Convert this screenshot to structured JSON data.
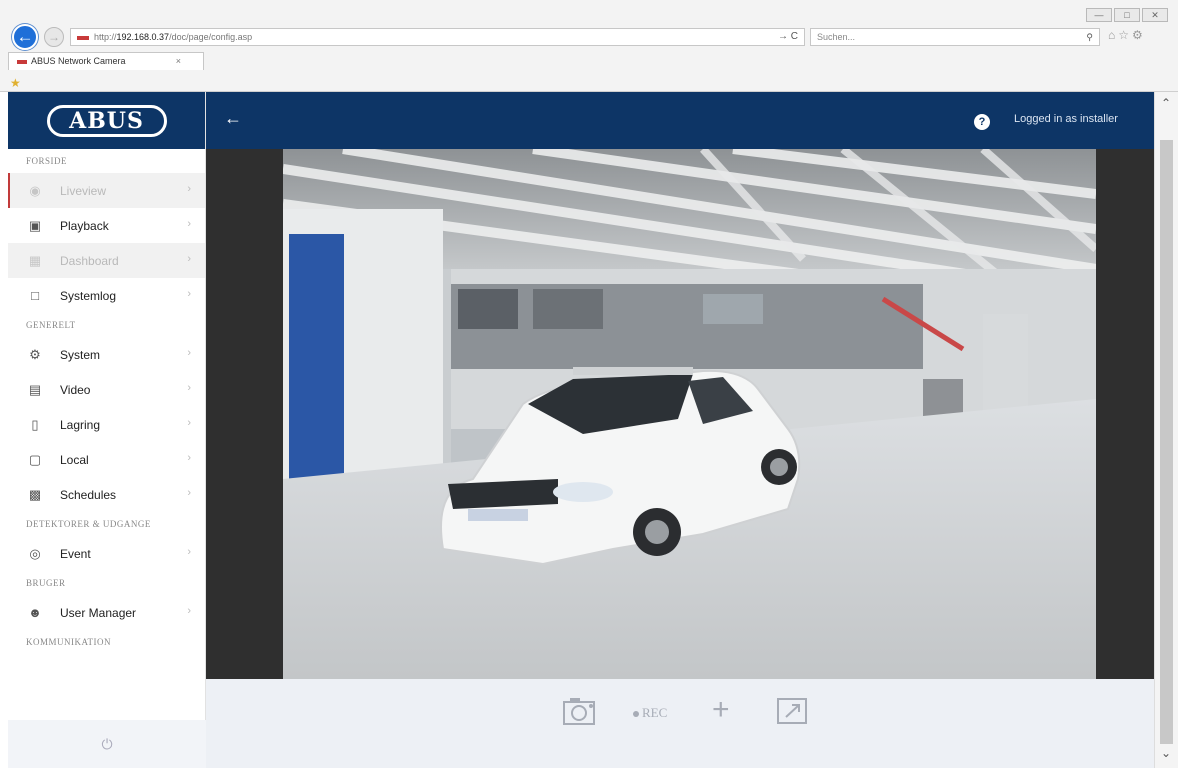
{
  "browser": {
    "url_prefix": "http://",
    "url_host": "192.168.0.37",
    "url_path": "/doc/page/config.asp",
    "url_tools": "→ C",
    "search_placeholder": "Suchen...",
    "search_icon": "search-icon",
    "tab_title": "ABUS Network Camera",
    "tab_close": "×"
  },
  "logo": {
    "text": "ABUS"
  },
  "sidebar": {
    "section_forside": "FORSIDE",
    "section_generelt": "GENERELT",
    "section_detektorer": "DETEKTORER & UDGANGE",
    "section_bruger": "BRUGER",
    "section_kommunikation": "KOMMUNIKATION",
    "items": {
      "liveview": {
        "label": "Liveview",
        "icon": "camera-icon"
      },
      "playback": {
        "label": "Playback",
        "icon": "playback-icon"
      },
      "dashboard": {
        "label": "Dashboard",
        "icon": "dashboard-icon"
      },
      "systemlog": {
        "label": "Systemlog",
        "icon": "document-icon"
      },
      "system": {
        "label": "System",
        "icon": "gear-icon"
      },
      "video": {
        "label": "Video",
        "icon": "video-icon"
      },
      "lagring": {
        "label": "Lagring",
        "icon": "storage-icon"
      },
      "local": {
        "label": "Local",
        "icon": "local-icon"
      },
      "schedules": {
        "label": "Schedules",
        "icon": "calendar-icon"
      },
      "event": {
        "label": "Event",
        "icon": "event-icon"
      },
      "user_manager": {
        "label": "User Manager",
        "icon": "user-icon"
      }
    }
  },
  "header": {
    "help": "?",
    "login_status": "Logged in as installer"
  },
  "toolbar": {
    "rec_label": "REC",
    "zoom_label": "+"
  },
  "colors": {
    "navy": "#0d3566",
    "active_marker": "#c23a3a",
    "toolbar_icon": "#a7acb6"
  }
}
